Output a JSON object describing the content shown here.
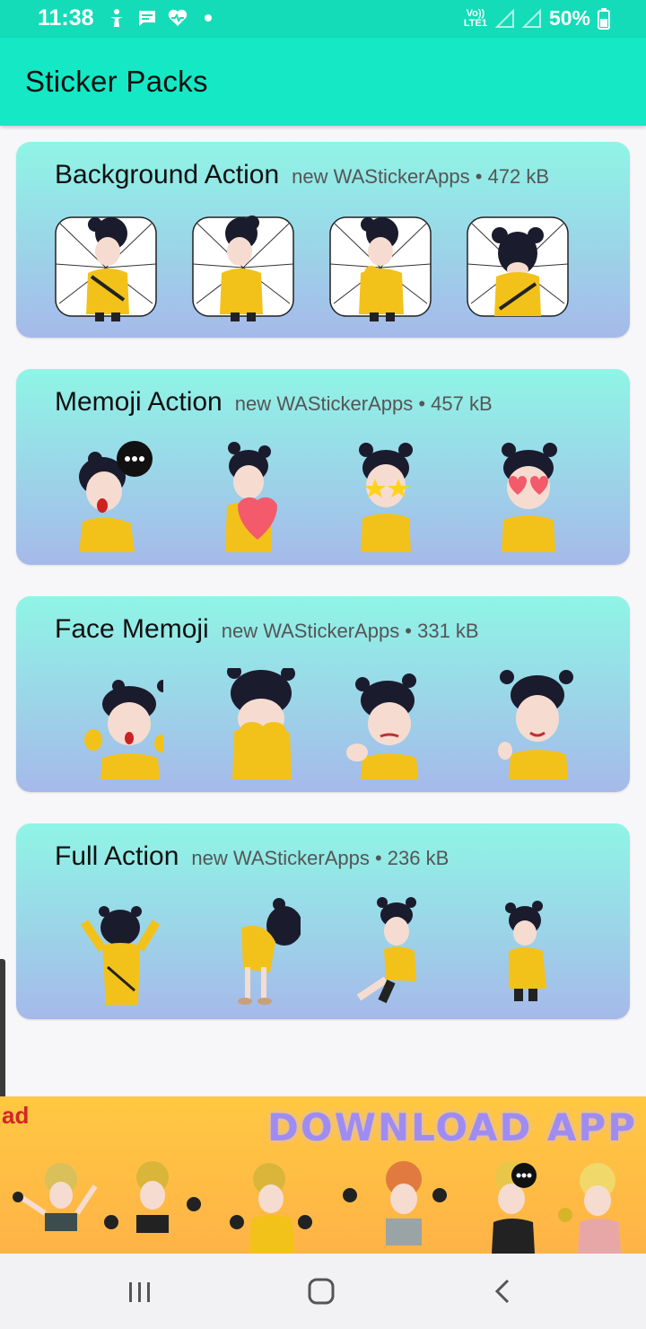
{
  "status_bar": {
    "time": "11:38",
    "battery": "50%",
    "network_label": "Vo)) LTE1"
  },
  "app_bar": {
    "title": "Sticker Packs"
  },
  "packs": [
    {
      "name": "Background Action",
      "meta": "new WAStickerApps • 472 kB"
    },
    {
      "name": "Memoji Action",
      "meta": "new WAStickerApps • 457 kB"
    },
    {
      "name": "Face Memoji",
      "meta": "new WAStickerApps • 331 kB"
    },
    {
      "name": "Full Action",
      "meta": "new WAStickerApps • 236 kB"
    }
  ],
  "ad": {
    "title": "DOWNLOAD APP",
    "left_text": "ad"
  },
  "colors": {
    "accent": "#14e8c4",
    "card_top": "#8ff5e6",
    "card_bottom": "#a6b9ea",
    "sticker_yellow": "#f2c21a"
  },
  "icons": {
    "status": [
      "accessibility-icon",
      "message-icon",
      "heart-icon",
      "dot-icon"
    ],
    "nav": [
      "recents-icon",
      "home-icon",
      "back-icon"
    ]
  }
}
